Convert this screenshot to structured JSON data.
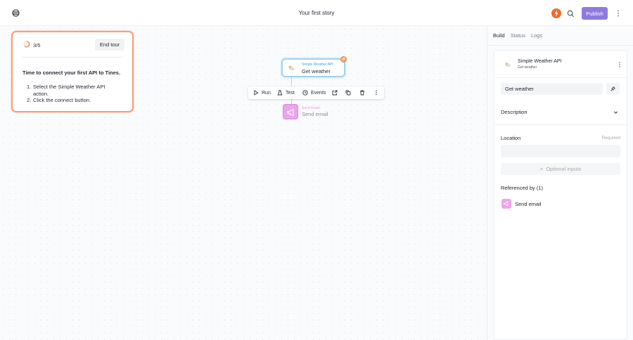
{
  "header": {
    "story_title": "Your first story",
    "publish_label": "Publish",
    "logo_icon": "tines-logo-icon",
    "avatar_color": "#f06a2a",
    "accent_color": "#8f79df"
  },
  "tour": {
    "progress": "3/5",
    "progress_fraction": 0.6,
    "end_label": "End tour",
    "heading": "Time to connect your first API to Tines.",
    "steps": [
      "Select the Simple Weather API action.",
      "Click the connect button."
    ]
  },
  "canvas": {
    "weather_node": {
      "type_label": "Simple Weather API",
      "name": "Get weather",
      "color": "#3ba5de"
    },
    "toolbar": {
      "run_label": "Run",
      "test_label": "Test",
      "events_label": "Events"
    },
    "email_node": {
      "type_label": "Send Email",
      "name": "Send email",
      "color": "#e9a6ea"
    }
  },
  "panel": {
    "tabs": [
      "Build",
      "Status",
      "Logs"
    ],
    "active_tab": "Build",
    "action_title": "Simple Weather API",
    "action_subtitle": "Get weather",
    "name_value": "Get weather",
    "description_label": "Description",
    "location_label": "Location",
    "location_required": "Required",
    "location_value": "",
    "optional_inputs_label": "Optional inputs",
    "referenced_by_label": "Referenced by (1)",
    "references": [
      "Send email"
    ]
  }
}
